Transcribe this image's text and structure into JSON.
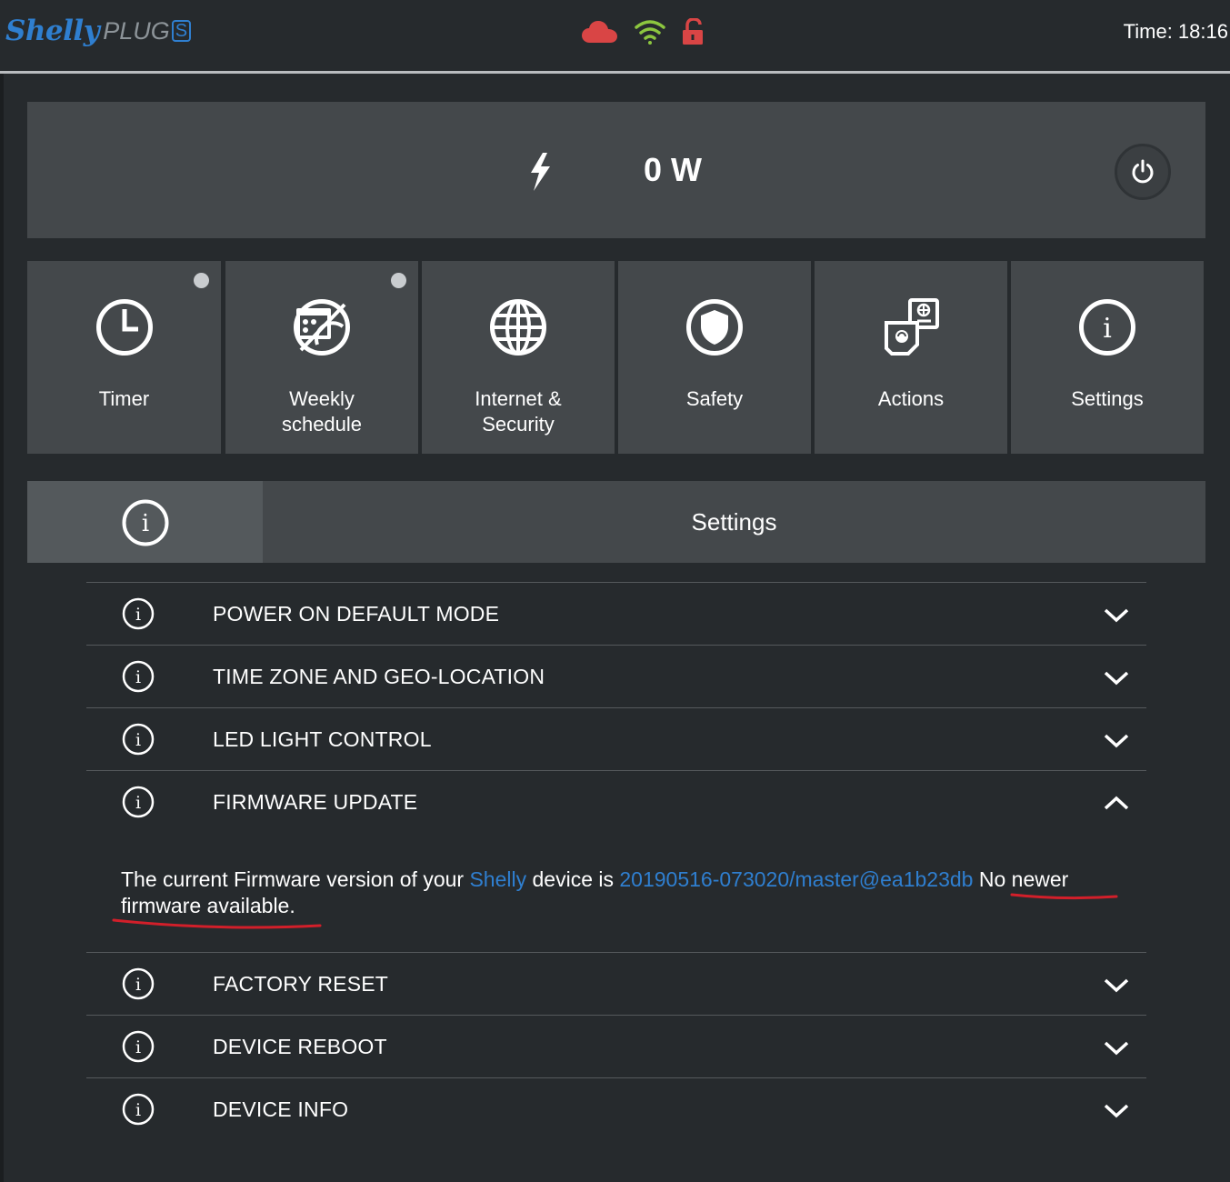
{
  "header": {
    "logo_brand": "Shelly",
    "logo_model": "PLUG",
    "logo_model_suffix": "S",
    "time_text": "Time: 18:16",
    "status_icons": [
      "cloud-icon",
      "wifi-icon",
      "unlocked-padlock-icon"
    ],
    "colors": {
      "cloud": "#d94545",
      "wifi": "#8cc63f",
      "lock": "#d94545",
      "brand": "#2f7fd0"
    }
  },
  "power": {
    "value": "0 W",
    "icon": "lightning-bolt-icon",
    "button_icon": "power-icon"
  },
  "tiles": [
    {
      "label": "Timer",
      "icon": "clock-icon",
      "indicator": true
    },
    {
      "label": "Weekly\nschedule",
      "icon": "weekly-schedule-icon",
      "indicator": true
    },
    {
      "label": "Internet &\nSecurity",
      "icon": "globe-icon",
      "indicator": false
    },
    {
      "label": "Safety",
      "icon": "shield-icon",
      "indicator": false
    },
    {
      "label": "Actions",
      "icon": "actions-icon",
      "indicator": false
    },
    {
      "label": "Settings",
      "icon": "info-icon",
      "indicator": false
    }
  ],
  "settings": {
    "title": "Settings",
    "items": [
      {
        "label": "POWER ON DEFAULT MODE",
        "expanded": false
      },
      {
        "label": "TIME ZONE AND GEO-LOCATION",
        "expanded": false
      },
      {
        "label": "LED LIGHT CONTROL",
        "expanded": false
      },
      {
        "label": "FIRMWARE UPDATE",
        "expanded": true
      },
      {
        "label": "FACTORY RESET",
        "expanded": false
      },
      {
        "label": "DEVICE REBOOT",
        "expanded": false
      },
      {
        "label": "DEVICE INFO",
        "expanded": false
      }
    ],
    "firmware": {
      "text_before": "The current Firmware version of your ",
      "device_name": "Shelly",
      "text_middle": " device is ",
      "version": "20190516-073020/master@ea1b23db",
      "status_text": " No newer firmware available."
    }
  }
}
